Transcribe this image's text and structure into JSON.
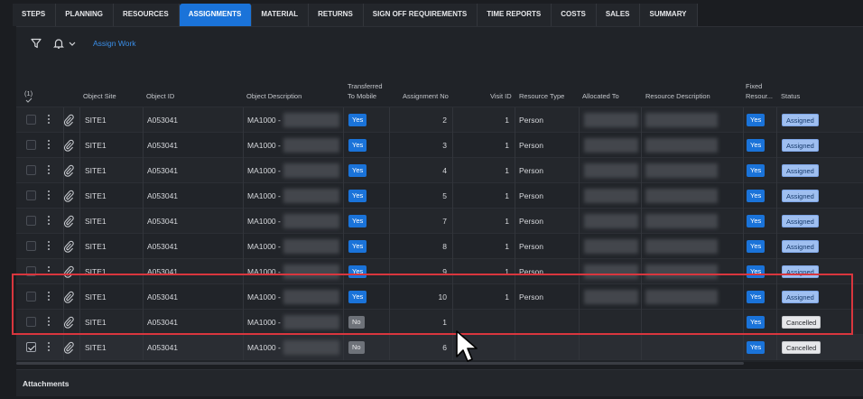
{
  "tabs": [
    {
      "label": "STEPS",
      "active": false
    },
    {
      "label": "PLANNING",
      "active": false
    },
    {
      "label": "RESOURCES",
      "active": false
    },
    {
      "label": "ASSIGNMENTS",
      "active": true
    },
    {
      "label": "MATERIAL",
      "active": false
    },
    {
      "label": "RETURNS",
      "active": false
    },
    {
      "label": "SIGN OFF REQUIREMENTS",
      "active": false
    },
    {
      "label": "TIME REPORTS",
      "active": false
    },
    {
      "label": "COSTS",
      "active": false
    },
    {
      "label": "SALES",
      "active": false
    },
    {
      "label": "SUMMARY",
      "active": false
    }
  ],
  "toolbar": {
    "filter_icon": "filter-icon",
    "bell_icon": "bell-icon",
    "assign_work_label": "Assign Work"
  },
  "table": {
    "selection_count": "(1)",
    "headers": {
      "object_site": "Object Site",
      "object_id": "Object ID",
      "object_description": "Object Description",
      "transferred_line1": "Transferred",
      "transferred_line2": "To Mobile",
      "assignment_no": "Assignment No",
      "visit_id": "Visit ID",
      "resource_type": "Resource Type",
      "allocated_to": "Allocated To",
      "resource_description": "Resource Description",
      "fixed_line1": "Fixed",
      "fixed_line2": "Resour...",
      "status": "Status"
    },
    "rows": [
      {
        "site": "SITE1",
        "object_id": "A053041",
        "desc": "MA1000 -",
        "transferred": "Yes",
        "assignment_no": "2",
        "visit_id": "1",
        "resource_type": "Person",
        "fixed": "Yes",
        "status": "Assigned",
        "checked": false
      },
      {
        "site": "SITE1",
        "object_id": "A053041",
        "desc": "MA1000 -",
        "transferred": "Yes",
        "assignment_no": "3",
        "visit_id": "1",
        "resource_type": "Person",
        "fixed": "Yes",
        "status": "Assigned",
        "checked": false
      },
      {
        "site": "SITE1",
        "object_id": "A053041",
        "desc": "MA1000 -",
        "transferred": "Yes",
        "assignment_no": "4",
        "visit_id": "1",
        "resource_type": "Person",
        "fixed": "Yes",
        "status": "Assigned",
        "checked": false
      },
      {
        "site": "SITE1",
        "object_id": "A053041",
        "desc": "MA1000 -",
        "transferred": "Yes",
        "assignment_no": "5",
        "visit_id": "1",
        "resource_type": "Person",
        "fixed": "Yes",
        "status": "Assigned",
        "checked": false
      },
      {
        "site": "SITE1",
        "object_id": "A053041",
        "desc": "MA1000 -",
        "transferred": "Yes",
        "assignment_no": "7",
        "visit_id": "1",
        "resource_type": "Person",
        "fixed": "Yes",
        "status": "Assigned",
        "checked": false
      },
      {
        "site": "SITE1",
        "object_id": "A053041",
        "desc": "MA1000 -",
        "transferred": "Yes",
        "assignment_no": "8",
        "visit_id": "1",
        "resource_type": "Person",
        "fixed": "Yes",
        "status": "Assigned",
        "checked": false
      },
      {
        "site": "SITE1",
        "object_id": "A053041",
        "desc": "MA1000 -",
        "transferred": "Yes",
        "assignment_no": "9",
        "visit_id": "1",
        "resource_type": "Person",
        "fixed": "Yes",
        "status": "Assigned",
        "checked": false
      },
      {
        "site": "SITE1",
        "object_id": "A053041",
        "desc": "MA1000 -",
        "transferred": "Yes",
        "assignment_no": "10",
        "visit_id": "1",
        "resource_type": "Person",
        "fixed": "Yes",
        "status": "Assigned",
        "checked": false
      },
      {
        "site": "SITE1",
        "object_id": "A053041",
        "desc": "MA1000 -",
        "transferred": "No",
        "assignment_no": "1",
        "visit_id": "",
        "resource_type": "",
        "fixed": "Yes",
        "status": "Cancelled",
        "checked": false
      },
      {
        "site": "SITE1",
        "object_id": "A053041",
        "desc": "MA1000 -",
        "transferred": "No",
        "assignment_no": "6",
        "visit_id": "",
        "resource_type": "",
        "fixed": "Yes",
        "status": "Cancelled",
        "checked": true
      }
    ]
  },
  "footer": {
    "attachments_label": "Attachments"
  },
  "colors": {
    "accent": "#1a73d9",
    "highlight": "#d9363e"
  }
}
